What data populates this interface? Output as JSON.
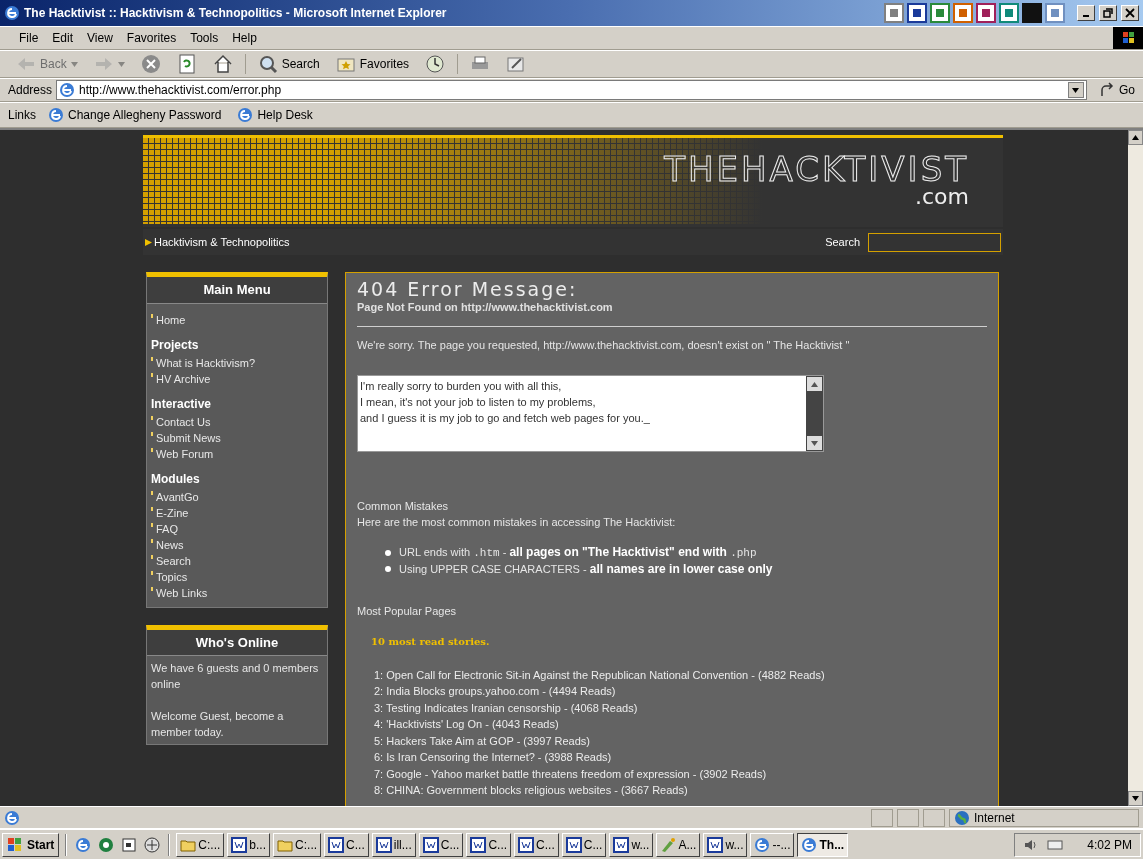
{
  "window": {
    "title": "The Hacktivist :: Hacktivism & Technopolitics - Microsoft Internet Explorer"
  },
  "menu_bar": [
    "File",
    "Edit",
    "View",
    "Favorites",
    "Tools",
    "Help"
  ],
  "toolbar": [
    {
      "kind": "back",
      "label": "Back",
      "disabled": true
    },
    {
      "kind": "forward",
      "disabled": true
    },
    {
      "kind": "stop",
      "disabled": false
    },
    {
      "kind": "refresh",
      "disabled": false
    },
    {
      "kind": "home",
      "disabled": false
    },
    {
      "kind": "search",
      "label": "Search",
      "disabled": false
    },
    {
      "kind": "favorites",
      "label": "Favorites",
      "disabled": false
    },
    {
      "kind": "history",
      "disabled": false
    },
    {
      "kind": "print",
      "disabled": false
    },
    {
      "kind": "edit",
      "disabled": false
    }
  ],
  "address": {
    "label": "Address",
    "value": "http://www.thehacktivist.com/error.php",
    "go": "Go"
  },
  "links_bar": {
    "label": "Links",
    "items": [
      "Change Allegheny Password",
      "Help Desk"
    ]
  },
  "site": {
    "logo": "THEHACKTIVIST",
    "logo_suffix": ".com",
    "tagline": "Hacktivism & Technopolitics",
    "search_label": "Search"
  },
  "main_menu": {
    "title": "Main Menu",
    "sections": [
      {
        "items": [
          "Home"
        ]
      },
      {
        "heading": "Projects",
        "items": [
          "What is Hacktivism?",
          "HV Archive"
        ]
      },
      {
        "heading": "Interactive",
        "items": [
          "Contact Us",
          "Submit News",
          "Web Forum"
        ]
      },
      {
        "heading": "Modules",
        "items": [
          "AvantGo",
          "E-Zine",
          "FAQ",
          "News",
          "Search",
          "Topics",
          "Web Links"
        ]
      }
    ]
  },
  "whos_online": {
    "title": "Who's Online",
    "paragraphs": [
      "We have 6 guests and 0 members online",
      "Welcome Guest, become a member today."
    ]
  },
  "content": {
    "title": "404 Error Message:",
    "subtitle": "Page Not Found on http://www.thehacktivist.com",
    "apology": "We're sorry. The page you requested, http://www.thehacktivist.com, doesn't exist on \" The Hacktivist \"",
    "poem": "I'm really sorry to burden you with all this,\nI mean, it's not your job to listen to my problems,\nand I guess it is my job to go and fetch web pages for you._",
    "mistakes_heading": "Common Mistakes",
    "mistakes_intro": "Here are the most common mistakes in accessing The Hacktivist:",
    "mistakes": [
      {
        "parts": [
          {
            "kind": "text",
            "text": "URL ends with "
          },
          {
            "kind": "code",
            "text": ".htm"
          },
          {
            "kind": "text",
            "text": " - "
          },
          {
            "kind": "bold",
            "text": "all pages on \"The Hacktivist\" end with "
          },
          {
            "kind": "code",
            "text": ".php"
          }
        ]
      },
      {
        "parts": [
          {
            "kind": "text",
            "text": "Using UPPER CASE CHARACTERS - "
          },
          {
            "kind": "bold",
            "text": "all names are in lower case only"
          }
        ]
      }
    ],
    "popular_heading": "Most Popular Pages",
    "stories_heading": "10 most read stories.",
    "stories": [
      "1: Open Call for Electronic Sit-in Against the Republican National Convention - (4882 Reads)",
      "2: India Blocks groups.yahoo.com - (4494 Reads)",
      "3: Testing Indicates Iranian censorship - (4068 Reads)",
      "4: 'Hacktivists' Log On - (4043 Reads)",
      "5: Hackers Take Aim at GOP - (3997 Reads)",
      "6: Is Iran Censoring the Internet? - (3988 Reads)",
      "7: Google - Yahoo market battle threatens freedom of expression - (3902 Reads)",
      "8: CHINA: Government blocks religious websites - (3667 Reads)"
    ]
  },
  "status_bar": {
    "zone": "Internet"
  },
  "taskbar": {
    "start": "Start",
    "tasks": [
      {
        "kind": "folder",
        "label": "C:...",
        "selected": false
      },
      {
        "kind": "word",
        "label": "b...",
        "selected": false
      },
      {
        "kind": "folder",
        "label": "C:...",
        "selected": false
      },
      {
        "kind": "word",
        "label": "C...",
        "selected": false
      },
      {
        "kind": "word",
        "label": "ill...",
        "selected": false
      },
      {
        "kind": "word",
        "label": "C...",
        "selected": false
      },
      {
        "kind": "word",
        "label": "C...",
        "selected": false
      },
      {
        "kind": "word",
        "label": "C...",
        "selected": false
      },
      {
        "kind": "word",
        "label": "C...",
        "selected": false
      },
      {
        "kind": "word",
        "label": "w...",
        "selected": false
      },
      {
        "kind": "paint",
        "label": "A...",
        "selected": false
      },
      {
        "kind": "word",
        "label": "w...",
        "selected": false
      },
      {
        "kind": "ie",
        "label": "--...",
        "selected": false
      },
      {
        "kind": "ie",
        "label": "Th...",
        "selected": true
      }
    ],
    "clock": "4:02 PM"
  }
}
